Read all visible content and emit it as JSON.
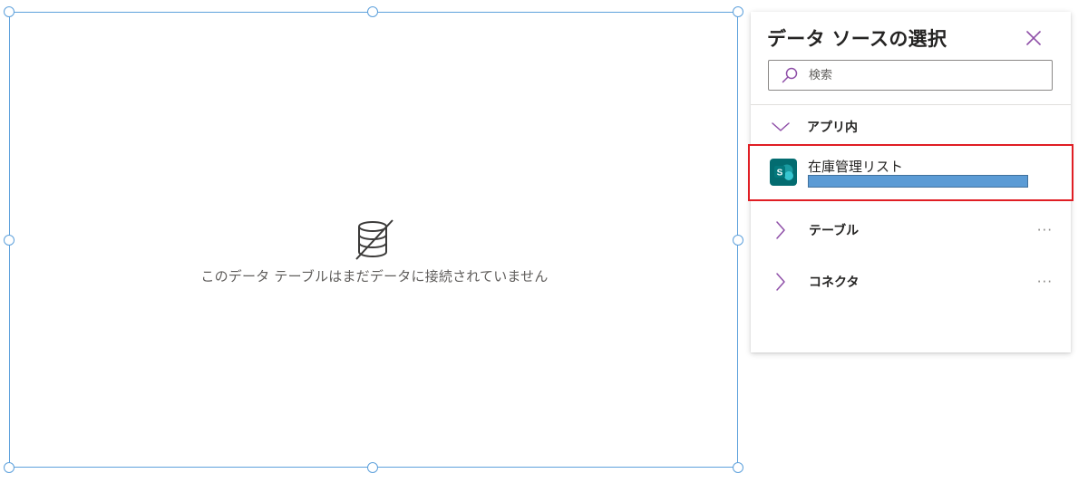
{
  "table_control": {
    "empty_message": "このデータ テーブルはまだデータに接続されていません"
  },
  "panel": {
    "title": "データ ソースの選択",
    "search": {
      "placeholder": "検索",
      "value": ""
    },
    "sections": {
      "in_app": {
        "label": "アプリ内",
        "expanded": true,
        "items": [
          {
            "name": "在庫管理リスト",
            "icon": "sharepoint-icon",
            "selected": true
          }
        ]
      },
      "tables": {
        "label": "テーブル",
        "expanded": false,
        "more": "···"
      },
      "connectors": {
        "label": "コネクタ",
        "expanded": false,
        "more": "···"
      }
    }
  },
  "colors": {
    "selection_border": "#5ea1dc",
    "accent": "#8f4fa8",
    "highlight_box": "#e01e24",
    "redaction_bar": "#5b9bd5",
    "sharepoint_tile": "#036c70"
  }
}
